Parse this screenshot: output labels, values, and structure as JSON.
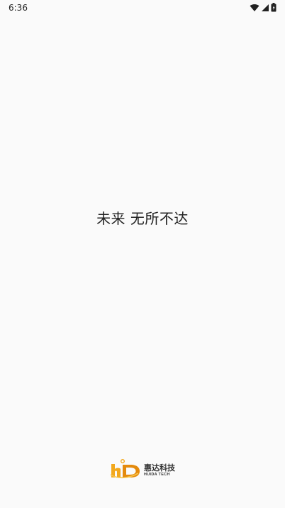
{
  "status_bar": {
    "time": "6:36",
    "icons": [
      "wifi-icon",
      "cell-signal-icon",
      "battery-icon"
    ]
  },
  "splash": {
    "slogan": "未来 无所不达"
  },
  "brand": {
    "name_cn": "惠达科技",
    "name_en": "HUIDA TECH",
    "logo_mark": "HD",
    "colors": {
      "accent": "#f2a81d",
      "accent_dark": "#e48a0c"
    }
  }
}
